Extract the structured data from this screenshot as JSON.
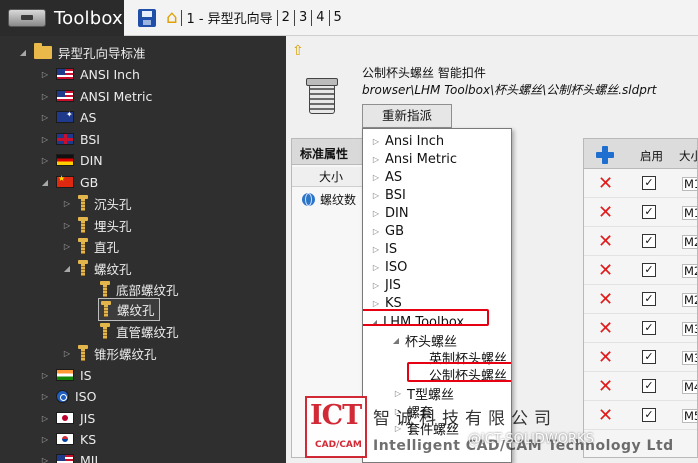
{
  "app": {
    "title": "Toolbox"
  },
  "toolbar": {
    "wizard_tabs": [
      "1 - 异型孔向导",
      "2",
      "3",
      "4",
      "5"
    ]
  },
  "tree": {
    "root": "异型孔向导标准",
    "standards": {
      "ansi_inch": "ANSI Inch",
      "ansi_metric": "ANSI Metric",
      "as": "AS",
      "bsi": "BSI",
      "din": "DIN",
      "gb": "GB",
      "is": "IS",
      "iso": "ISO",
      "jis": "JIS",
      "ks": "KS",
      "mil": "MIL"
    },
    "gb_children": {
      "counterbore": "沉头孔",
      "countersink": "埋头孔",
      "straight": "直孔",
      "tapped": "螺纹孔",
      "bottom_tapped": "底部螺纹孔",
      "tapped_hole": "螺纹孔",
      "pipe_tapped": "直管螺纹孔",
      "tapered_tapped": "锥形螺纹孔"
    }
  },
  "part": {
    "title": "公制杯头螺丝 智能扣件",
    "path": "browser\\LHM Toolbox\\杯头螺丝\\公制杯头螺丝.sldprt",
    "reassign_label": "重新指派"
  },
  "props": {
    "header": "标准属性",
    "col_size": "大小",
    "row_label": "螺纹数"
  },
  "grid": {
    "col_enable": "启用",
    "col_size": "大小",
    "rows": [
      "M1",
      "M1",
      "M2",
      "M2",
      "M2",
      "M3",
      "M3",
      "M4",
      "M5"
    ]
  },
  "dropdown": {
    "items": [
      "Ansi Inch",
      "Ansi Metric",
      "AS",
      "BSI",
      "DIN",
      "GB",
      "IS",
      "ISO",
      "JIS",
      "KS"
    ],
    "lhm": "LHM Toolbox",
    "cup_head": "杯头螺丝",
    "imperial_cup": "英制杯头螺丝",
    "metric_cup": "公制杯头螺丝",
    "t_bolt": "T型螺丝",
    "set_screw": "螺套",
    "stud": "套件螺丝"
  },
  "watermark": {
    "logo_text": "ICT",
    "logo_sub": "CAD/CAM",
    "company_cn": "智诚科技有限公司",
    "company_en": "Intelligent CAD/CAM Technology Ltd",
    "handle": "@ICT-SOLIDWORKS"
  },
  "colors": {
    "highlight": "#e60012",
    "tree_bg": "#2f2f30",
    "delete": "#e01b1b",
    "add": "#1e6fd0"
  }
}
